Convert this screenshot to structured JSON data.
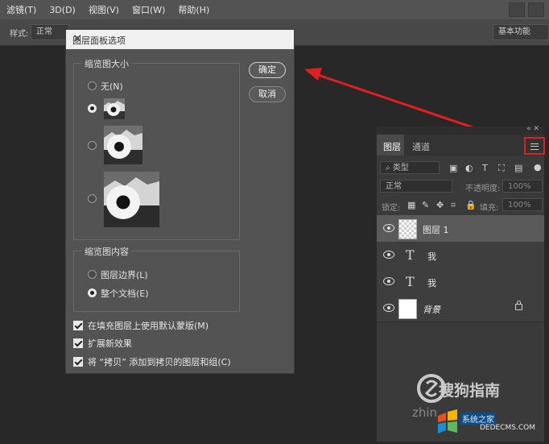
{
  "menubar": {
    "items": [
      "滤镜(T)",
      "3D(D)",
      "视图(V)",
      "窗口(W)",
      "帮助(H)"
    ]
  },
  "options_bar": {
    "style_label": "样式:",
    "style_value": "正常",
    "workspace": "基本功能"
  },
  "dialog": {
    "title": "图层面板选项",
    "thumbnail_group": {
      "label": "缩览图大小",
      "options": [
        {
          "label": "无(N)",
          "selected": false
        },
        {
          "label": "",
          "selected": true,
          "size": "small"
        },
        {
          "label": "",
          "selected": false,
          "size": "medium"
        },
        {
          "label": "",
          "selected": false,
          "size": "large"
        }
      ]
    },
    "content_group": {
      "label": "缩览图内容",
      "options": [
        {
          "label": "图层边界(L)",
          "selected": false
        },
        {
          "label": "整个文档(E)",
          "selected": true
        }
      ]
    },
    "checkboxes": [
      {
        "label": "在填充图层上使用默认蒙版(M)",
        "checked": true
      },
      {
        "label": "扩展新效果",
        "checked": true
      },
      {
        "label": "将 “拷贝” 添加到拷贝的图层和组(C)",
        "checked": true
      }
    ],
    "ok_label": "确定",
    "cancel_label": "取消"
  },
  "layers_panel": {
    "tabs": [
      "图层",
      "通道"
    ],
    "filter_label": "类型",
    "blend_mode": "正常",
    "opacity_label": "不透明度:",
    "opacity_value": "100%",
    "lock_label": "锁定:",
    "fill_label": "填充:",
    "fill_value": "100%",
    "layers": [
      {
        "name": "图层 1",
        "kind": "raster",
        "selected": true,
        "locked": false
      },
      {
        "name": "我",
        "kind": "text",
        "selected": false,
        "locked": false
      },
      {
        "name": "我",
        "kind": "text",
        "selected": false,
        "locked": false
      },
      {
        "name": "背景",
        "kind": "background",
        "selected": false,
        "locked": true
      }
    ]
  },
  "watermark": {
    "brand": "搜狗指南",
    "prefix": "zhin",
    "site": "系统之家",
    "url": "DEDECMS.COM"
  },
  "colors": {
    "annotation": "#e02020",
    "panel_bg": "#3a3a3a",
    "dialog_bg": "#535353"
  }
}
